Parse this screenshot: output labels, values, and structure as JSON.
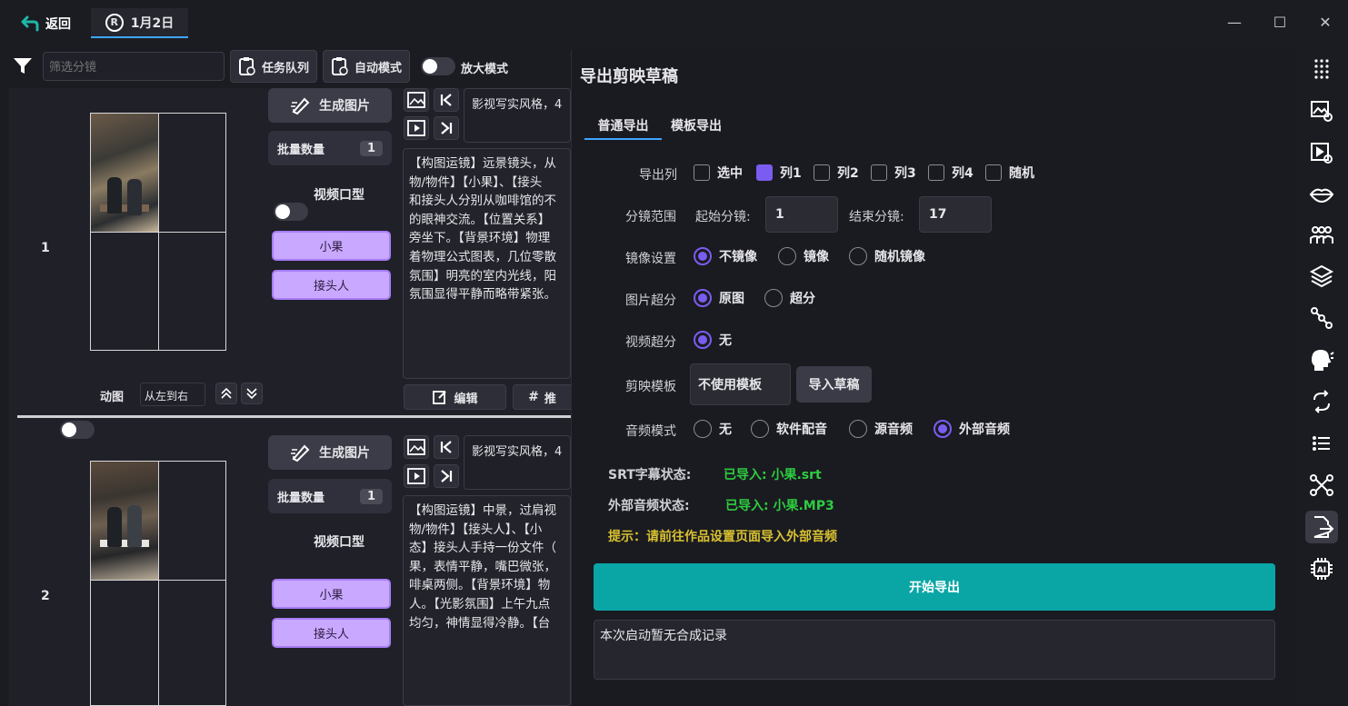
{
  "titlebar": {
    "back_label": "返回",
    "tab_icon": "R",
    "tab_label": "1月2日"
  },
  "window": {
    "minimize": "—",
    "maximize": "☐",
    "close": "✕"
  },
  "toolbar": {
    "filter_placeholder": "筛选分镜",
    "task_queue_label": "任务队列",
    "auto_mode_label": "自动模式",
    "zoom_mode_label": "放大模式"
  },
  "storyboard": {
    "rows": [
      {
        "index": "1",
        "generate_label": "生成图片",
        "batch_label": "批量数量",
        "batch_value": "1",
        "lipsync_label": "视频口型",
        "roles": [
          "小果",
          "接头人"
        ],
        "prompt_preview": "影视写实风格，4",
        "description": "【构图运镜】远景镜头，从物/物件】【小果】、【接头和接头人分别从咖啡馆的不的眼神交流。【位置关系】旁坐下。【背景环境】物理着物理公式图表，几位零散氛围】明亮的室内光线，阳氛围显得平静而略带紧张。",
        "desc_lines": [
          "【构图运镜】远景镜头，从",
          "物/物件】【小果】、【接头",
          "和接头人分别从咖啡馆的不",
          "的眼神交流。【位置关系】",
          "旁坐下。【背景环境】物理",
          "着物理公式图表，几位零散",
          "氛围】明亮的室内光线，阳",
          "氛围显得平静而略带紧张。"
        ],
        "animate_label": "动图",
        "direction_value": "从左到右",
        "edit_label": "编辑",
        "second_label": "推"
      },
      {
        "index": "2",
        "generate_label": "生成图片",
        "batch_label": "批量数量",
        "batch_value": "1",
        "lipsync_label": "视频口型",
        "roles": [
          "小果",
          "接头人"
        ],
        "prompt_preview": "影视写实风格，4",
        "desc_lines": [
          "【构图运镜】中景，过肩视",
          "物/物件】【接头人】、【小",
          "态】接头人手持一份文件（",
          "果，表情平静，嘴巴微张，",
          "啡桌两侧。【背景环境】物",
          "人。【光影氛围】上午九点",
          "均匀，神情显得冷静。【台"
        ]
      }
    ]
  },
  "export": {
    "title": "导出剪映草稿",
    "tabs": [
      "普通导出",
      "模板导出"
    ],
    "columns_label": "导出列",
    "columns": [
      {
        "label": "选中",
        "checked": false
      },
      {
        "label": "列1",
        "checked": true
      },
      {
        "label": "列2",
        "checked": false
      },
      {
        "label": "列3",
        "checked": false
      },
      {
        "label": "列4",
        "checked": false
      },
      {
        "label": "随机",
        "checked": false
      }
    ],
    "range_label": "分镜范围",
    "start_label": "起始分镜:",
    "start_value": "1",
    "end_label": "结束分镜:",
    "end_value": "17",
    "mirror_label": "镜像设置",
    "mirror_options": [
      "不镜像",
      "镜像",
      "随机镜像"
    ],
    "mirror_selected": 0,
    "image_sr_label": "图片超分",
    "image_sr_options": [
      "原图",
      "超分"
    ],
    "video_sr_label": "视频超分",
    "video_sr_options": [
      "无"
    ],
    "template_label": "剪映模板",
    "template_value": "不使用模板",
    "import_draft_label": "导入草稿",
    "audio_label": "音频模式",
    "audio_options": [
      "无",
      "软件配音",
      "源音频",
      "外部音频"
    ],
    "audio_selected": 3,
    "srt_status_label": "SRT字幕状态:",
    "srt_status_value": "已导入: 小果.srt",
    "audio_status_label": "外部音频状态:",
    "audio_status_value": "已导入: 小果.MP3",
    "hint": "提示：请前往作品设置页面导入外部音频",
    "start_button": "开始导出",
    "log_text": "本次启动暂无合成记录"
  },
  "colors": {
    "accent": "#7b5cf0",
    "teal": "#0aa6a6",
    "success": "#2ecc40",
    "warning": "#d9c130",
    "role_bg": "#c9a8ff"
  },
  "sidebar_icons": [
    "dots-grid-icon",
    "image-settings-icon",
    "video-settings-icon",
    "lips-icon",
    "people-icon",
    "layers-icon",
    "nodes-icon",
    "speaking-head-icon",
    "sync-icon",
    "list-icon",
    "network-icon",
    "export-icon",
    "ai-chip-icon"
  ]
}
